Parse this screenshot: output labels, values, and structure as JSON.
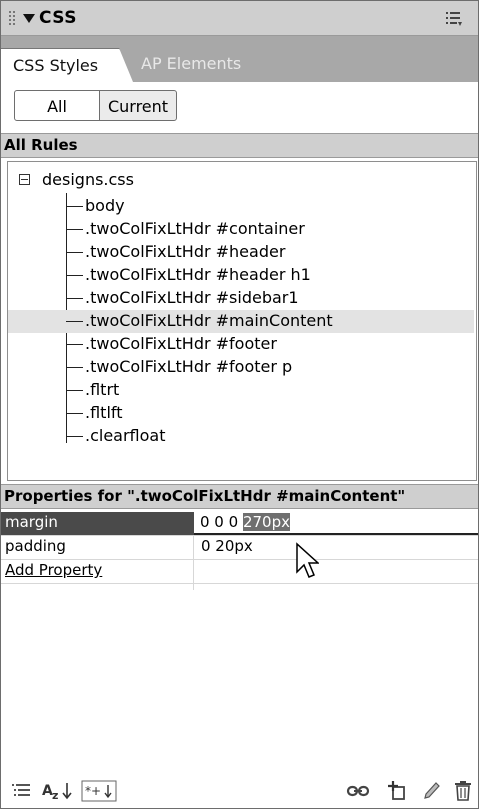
{
  "panel": {
    "title": "CSS",
    "tabs": [
      "CSS Styles",
      "AP Elements"
    ],
    "toggle": {
      "all": "All",
      "current": "Current"
    }
  },
  "rules": {
    "header": "All Rules",
    "root": "designs.css",
    "items": [
      "body",
      ".twoColFixLtHdr #container",
      ".twoColFixLtHdr #header",
      ".twoColFixLtHdr #header h1",
      ".twoColFixLtHdr #sidebar1",
      ".twoColFixLtHdr #mainContent",
      ".twoColFixLtHdr #footer",
      ".twoColFixLtHdr #footer p",
      ".fltrt",
      ".fltlft",
      ".clearfloat"
    ],
    "selected_index": 5
  },
  "properties": {
    "header": "Properties for \".twoColFixLtHdr #mainContent\"",
    "rows": [
      {
        "name": "margin",
        "value_plain": "0 0 0 ",
        "value_selected": "270px"
      },
      {
        "name": "padding",
        "value": "0 20px"
      }
    ],
    "add_property": "Add Property"
  },
  "icons": {
    "title_menu": "options-menu-icon",
    "bottom_left": [
      "category-view-icon",
      "alphabetical-view-icon",
      "set-properties-view-icon"
    ],
    "bottom_right": [
      "attach-stylesheet-icon",
      "new-css-rule-icon",
      "edit-style-icon",
      "delete-css-rule-icon"
    ]
  }
}
